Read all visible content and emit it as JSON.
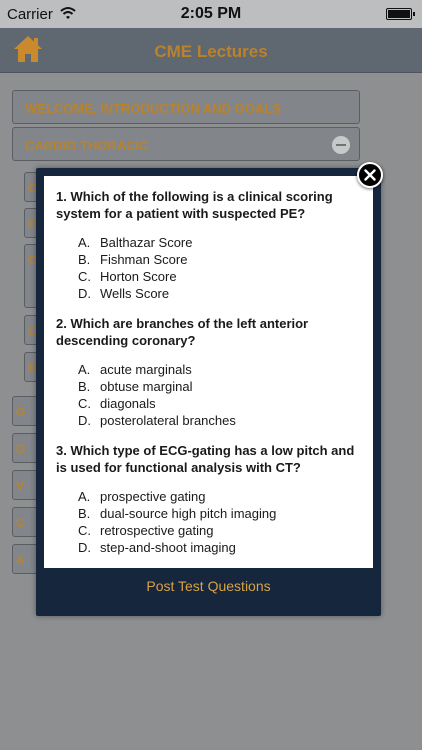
{
  "status_bar": {
    "carrier": "Carrier",
    "time": "2:05 PM"
  },
  "nav": {
    "title": "CME Lectures",
    "home_icon": "home-icon"
  },
  "sections": [
    {
      "label": "WELCOME, INTRODUCTION AND GOALS"
    },
    {
      "label": "CARDIO THORACIC",
      "icon": "minus-circle-icon"
    }
  ],
  "list_stubs": {
    "items": [
      "C",
      "C",
      "C",
      "C",
      "E"
    ],
    "sections": [
      "G",
      "G",
      "V",
      "C",
      "A"
    ]
  },
  "modal": {
    "questions": [
      {
        "text": "1.  Which of the following is a clinical scoring system for a patient with suspected PE?",
        "answers": [
          {
            "letter": "A.",
            "text": "Balthazar Score"
          },
          {
            "letter": "B.",
            "text": "Fishman Score"
          },
          {
            "letter": "C.",
            "text": "Horton Score"
          },
          {
            "letter": "D.",
            "text": "Wells Score"
          }
        ]
      },
      {
        "text": "2.  Which are branches of the left anterior descending coronary?",
        "answers": [
          {
            "letter": "A.",
            "text": "acute marginals"
          },
          {
            "letter": "B.",
            "text": "obtuse marginal"
          },
          {
            "letter": "C.",
            "text": "diagonals"
          },
          {
            "letter": "D.",
            "text": "posterolateral branches"
          }
        ]
      },
      {
        "text": "3.  Which type of ECG-gating has a low pitch and is used for functional analysis with CT?",
        "answers": [
          {
            "letter": "A.",
            "text": "prospective gating"
          },
          {
            "letter": "B.",
            "text": "dual-source high pitch imaging"
          },
          {
            "letter": "C.",
            "text": "retrospective gating"
          },
          {
            "letter": "D.",
            "text": "step-and-shoot imaging"
          }
        ]
      }
    ],
    "footer_link": "Post Test Questions"
  },
  "colors": {
    "accent": "#b9822c",
    "modal_frame": "#16263d",
    "nav": "#5f6771"
  }
}
